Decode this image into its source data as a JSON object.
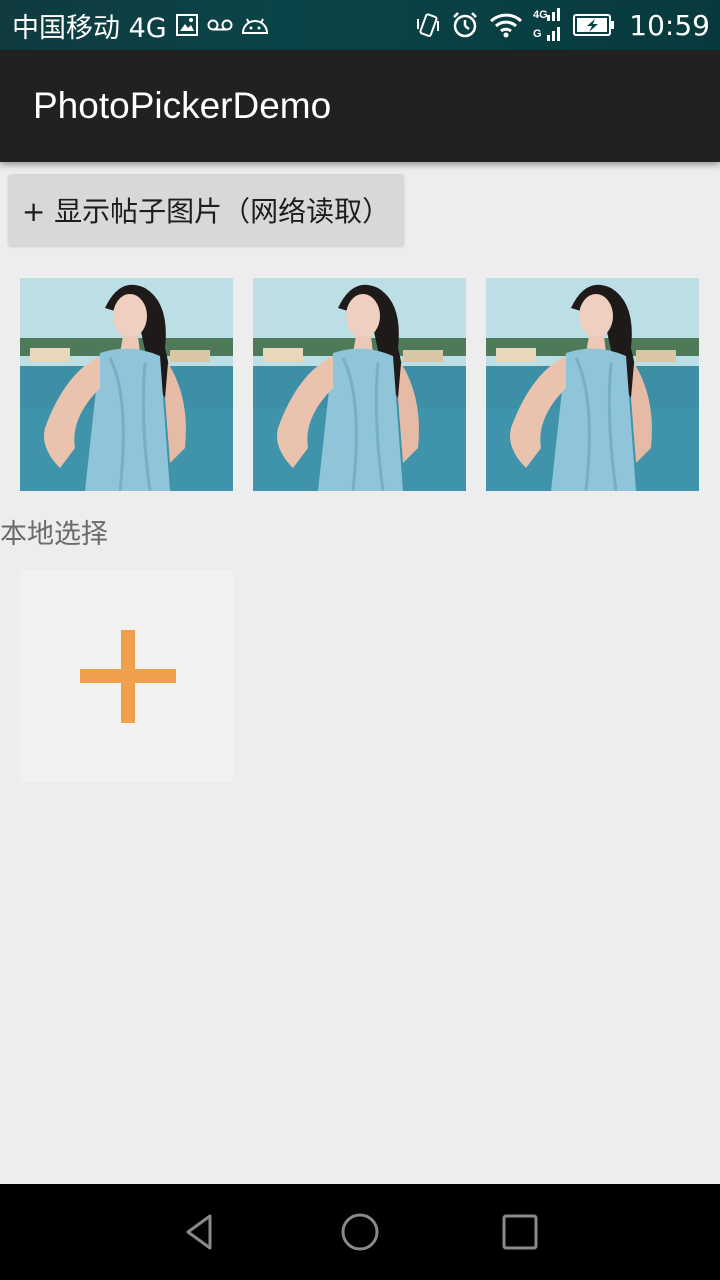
{
  "status_bar": {
    "carrier": "中国移动 4G",
    "time": "10:59",
    "icons": [
      "image-notification-icon",
      "voicemail-icon",
      "android-icon",
      "vibrate-icon",
      "alarm-icon",
      "wifi-icon",
      "signal-4g-icon",
      "battery-charging-icon"
    ],
    "signal_label_top": "4G",
    "signal_label_bottom": "G"
  },
  "app_bar": {
    "title": "PhotoPickerDemo"
  },
  "main": {
    "show_button_label": "+ 显示帖子图片（网络读取）",
    "network_photos": [
      {
        "name": "network-photo-1"
      },
      {
        "name": "network-photo-2"
      },
      {
        "name": "network-photo-3"
      }
    ],
    "local_section_label": "本地选择",
    "add_icon": "plus-icon"
  },
  "nav_bar": {
    "icons": [
      "back-icon",
      "home-icon",
      "recents-icon"
    ]
  },
  "colors": {
    "status_bar": "#0b4448",
    "app_bar": "#212121",
    "background": "#ededed",
    "button": "#d7d8d8",
    "accent_plus": "#f0a04b",
    "nav_bar": "#000000"
  }
}
